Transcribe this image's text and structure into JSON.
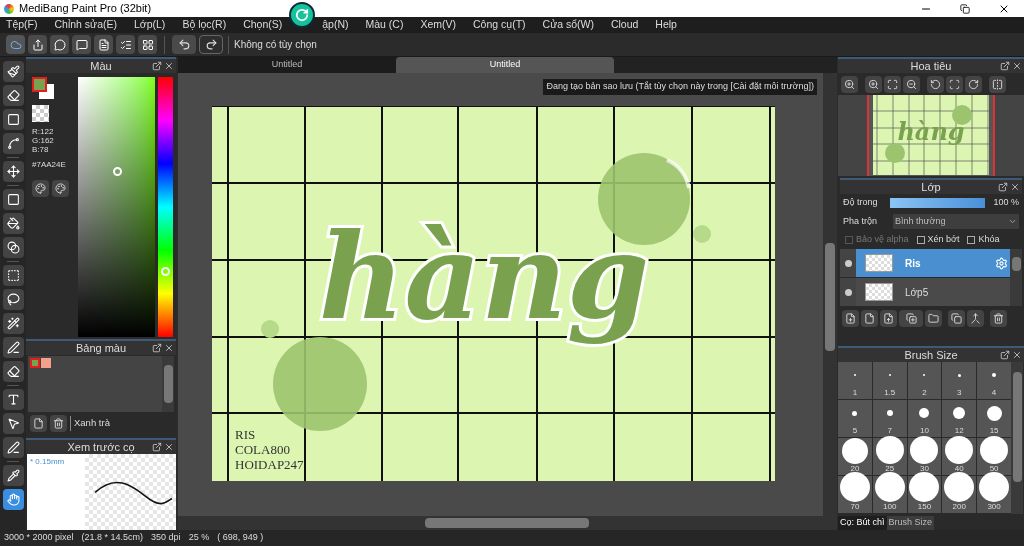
{
  "window": {
    "title": "MediBang Paint Pro (32bit)"
  },
  "menu": [
    "Tệp(F)",
    "Chỉnh sửa(E)",
    "Lớp(L)",
    "Bộ lọc(R)",
    "Chọn(S)",
    "ập(N)",
    "Màu (C)",
    "Xem(V)",
    "Công cụ(T)",
    "Cửa sổ(W)",
    "Cloud",
    "Help"
  ],
  "toolbar": {
    "option_text": "Không có tùy chọn"
  },
  "tools": [
    {
      "selected": false
    },
    {
      "selected": false
    },
    {
      "selected": false
    },
    {
      "selected": false
    },
    {
      "selected": false
    },
    {
      "selected": false
    },
    {
      "selected": false
    },
    {
      "selected": false
    },
    {
      "selected": false
    },
    {
      "selected": false
    },
    {
      "selected": false
    },
    {
      "selected": false
    },
    {
      "selected": false
    },
    {
      "selected": false
    },
    {
      "selected": false
    },
    {
      "selected": false
    },
    {
      "selected": false
    },
    {
      "selected": true
    }
  ],
  "color_panel": {
    "title": "Màu",
    "swatches": [
      {
        "color": "#7aa24e"
      },
      {
        "color": "#ffffff"
      }
    ],
    "r": "R:122",
    "g": "G:162",
    "b": "B:78",
    "hex": "#7AA24E",
    "hue_slider": {
      "level": 0.25
    }
  },
  "palette": {
    "title": "Bảng màu",
    "colors": [
      {
        "color": "#7aa24e",
        "selected": true
      },
      {
        "color": "#f4a08a",
        "selected": false
      }
    ],
    "name": "Xanh trà"
  },
  "brush_preview": {
    "title": "Xem trước cọ",
    "size": "* 0.15mm"
  },
  "tabs": [
    {
      "label": "Untitled",
      "selected": false
    },
    {
      "label": "Untitled",
      "selected": true
    }
  ],
  "notice": "Đang tạo bản sao lưu (Tắt tùy chọn này trong [Cài đặt môi trường])",
  "artwork": {
    "headline": "hàng",
    "credits": [
      "RIS",
      "COLA800",
      "HOIDAP247"
    ]
  },
  "navigator": {
    "title": "Hoa tiêu",
    "caption": "hàng"
  },
  "layers_panel": {
    "title": "Lớp",
    "opacity_label": "Độ trong",
    "opacity": {
      "level": 1
    },
    "opacity_text": "100 %",
    "blend_label": "Pha trộn",
    "blend_value": "Bình thường",
    "options": [
      {
        "label": "Bảo vệ alpha",
        "checked": false,
        "disabled": true
      },
      {
        "label": "Xén bớt",
        "checked": false,
        "disabled": false
      },
      {
        "label": "Khóa",
        "checked": false,
        "disabled": false
      }
    ],
    "layers": [
      {
        "name": "Ris",
        "selected": true,
        "visible": true
      },
      {
        "name": "Lớp5",
        "selected": false,
        "visible": true
      }
    ]
  },
  "brush_size": {
    "title": "Brush Size",
    "sizes": [
      "1",
      "1.5",
      "2",
      "3",
      "4",
      "5",
      "7",
      "10",
      "12",
      "15",
      "20",
      "25",
      "30",
      "40",
      "50",
      "70",
      "100",
      "150",
      "200",
      "300"
    ]
  },
  "bottom_tabs": [
    {
      "label": "Cọ: Bút chì",
      "selected": false
    },
    {
      "label": "Brush Size",
      "selected": true
    }
  ],
  "status": [
    "3000 * 2000 pixel",
    "(21.8 * 14.5cm)",
    "350 dpi",
    "25 %",
    "( 698, 949 )"
  ]
}
